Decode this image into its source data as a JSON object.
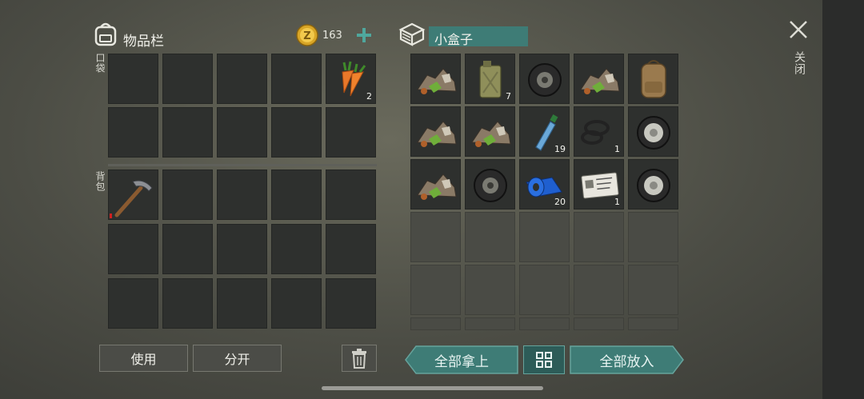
{
  "inventory": {
    "title": "物品栏",
    "coins": "163",
    "pocket_label": "口袋",
    "backpack_label": "背包",
    "pocket_slots": [
      {
        "item": "",
        "count": ""
      },
      {
        "item": "",
        "count": ""
      },
      {
        "item": "",
        "count": ""
      },
      {
        "item": "",
        "count": ""
      },
      {
        "item": "carrot-icon",
        "count": "2"
      },
      {
        "item": "",
        "count": ""
      },
      {
        "item": "",
        "count": ""
      },
      {
        "item": "",
        "count": ""
      },
      {
        "item": "",
        "count": ""
      },
      {
        "item": "",
        "count": ""
      }
    ],
    "backpack_slots": [
      {
        "item": "pickaxe-icon",
        "count": ""
      }
    ],
    "use_label": "使用",
    "split_label": "分开"
  },
  "container": {
    "title": "小盒子",
    "slots": [
      {
        "item": "scrap-pile-icon",
        "count": ""
      },
      {
        "item": "jerrycan-icon",
        "count": "7"
      },
      {
        "item": "tire-icon",
        "count": ""
      },
      {
        "item": "scrap-pile-icon",
        "count": ""
      },
      {
        "item": "backpack-item-icon",
        "count": ""
      },
      {
        "item": "scrap-pile-icon",
        "count": ""
      },
      {
        "item": "scrap-pile-icon",
        "count": ""
      },
      {
        "item": "water-bottle-icon",
        "count": "19"
      },
      {
        "item": "rubber-rings-icon",
        "count": "1"
      },
      {
        "item": "wheel-icon",
        "count": ""
      },
      {
        "item": "scrap-pile-icon",
        "count": ""
      },
      {
        "item": "tire-icon",
        "count": ""
      },
      {
        "item": "duct-tape-icon",
        "count": "20"
      },
      {
        "item": "id-card-icon",
        "count": "1"
      },
      {
        "item": "wheel-icon",
        "count": ""
      }
    ],
    "take_all_label": "全部拿上",
    "put_all_label": "全部放入"
  },
  "close_label": "关闭",
  "colors": {
    "teal": "#3e7c76",
    "teal_dark": "#2d5c58",
    "slot": "#2e302e"
  }
}
